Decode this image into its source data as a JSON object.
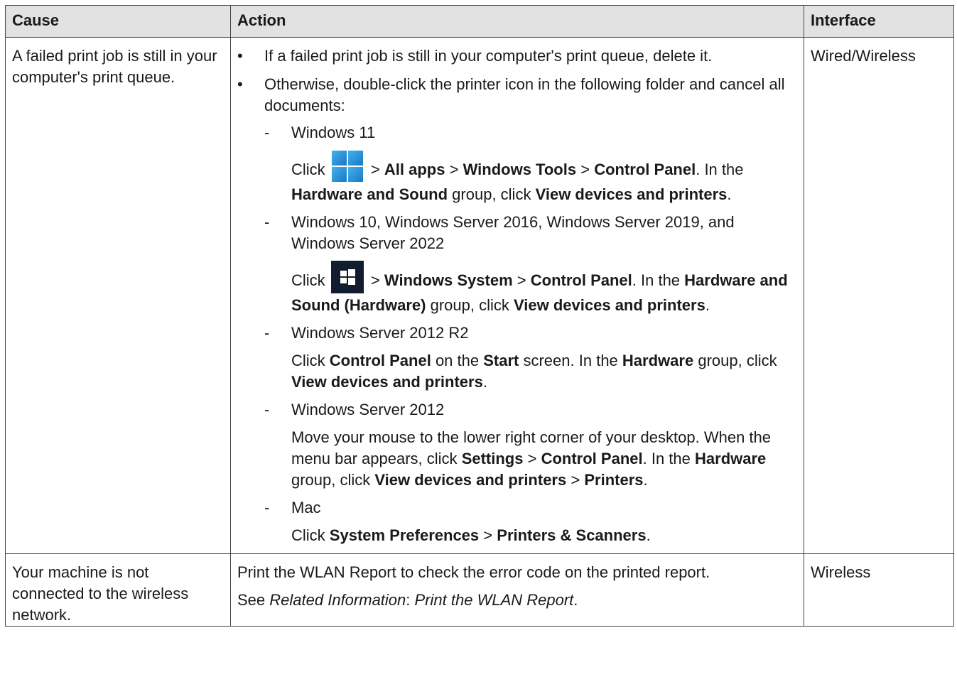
{
  "headers": {
    "cause": "Cause",
    "action": "Action",
    "interface": "Interface"
  },
  "row1": {
    "cause": "A failed print job is still in your computer's print queue.",
    "interface": "Wired/Wireless",
    "bullet1": "If a failed print job is still in your computer's print queue, delete it.",
    "bullet2": "Otherwise, double-click the printer icon in the following folder and cancel all documents:",
    "win11": {
      "os": "Windows 11",
      "click": "Click",
      "sep1": ">",
      "all_apps": "All apps",
      "sep2": ">",
      "windows_tools": "Windows Tools",
      "sep3": ">",
      "control_panel": "Control Panel",
      "in_the": ". In the",
      "hardware_sound": "Hardware and Sound",
      "group_click": "group, click",
      "view_devices": "View devices and printers",
      "end": ".",
      "icon": "windows-11-start-icon"
    },
    "win10": {
      "os": "Windows 10, Windows Server 2016, Windows Server 2019, and Windows Server 2022",
      "click": "Click",
      "sep1": ">",
      "windows_system": "Windows System",
      "sep2": ">",
      "control_panel": "Control Panel",
      "in_the": ". In the",
      "hardware_sound": "Hardware and Sound (Hardware)",
      "group_click": "group, click",
      "view_devices": "View devices and printers",
      "end": ".",
      "icon": "windows-10-start-icon"
    },
    "ws2012r2": {
      "os": "Windows Server 2012 R2",
      "click": "Click",
      "control_panel": "Control Panel",
      "on_the": "on the",
      "start": "Start",
      "screen": "screen. In the",
      "hardware": "Hardware",
      "group_click": "group, click",
      "view_devices": "View devices and printers",
      "end": "."
    },
    "ws2012": {
      "os": "Windows Server 2012",
      "move": "Move your mouse to the lower right corner of your desktop. When the menu bar appears, click",
      "settings": "Settings",
      "sep1": ">",
      "control_panel": "Control Panel",
      "in_the": ". In the",
      "hardware": "Hardware",
      "group_click": "group, click",
      "view_devices": "View devices and printers",
      "sep2": ">",
      "printers": "Printers",
      "end": "."
    },
    "mac": {
      "os": "Mac",
      "click": "Click",
      "system_prefs": "System Preferences",
      "sep1": ">",
      "printers_scanners": "Printers & Scanners",
      "end": "."
    }
  },
  "row2": {
    "cause": "Your machine is not connected to the wireless network.",
    "interface": "Wireless",
    "line1": "Print the WLAN Report to check the error code on the printed report.",
    "see": "See",
    "related": "Related Information",
    "colon": ":",
    "report_link": "Print the WLAN Report",
    "end": "."
  }
}
